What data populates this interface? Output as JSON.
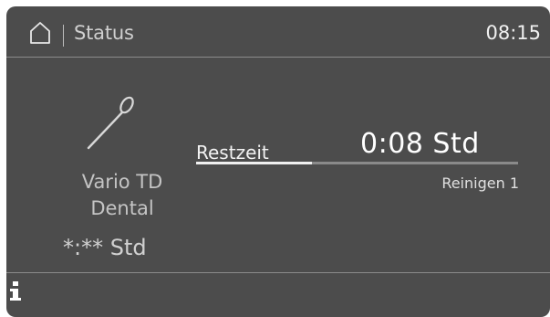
{
  "header": {
    "home_icon": "home-icon",
    "title": "Status",
    "clock": "08:15"
  },
  "program": {
    "icon": "dental-mirror-icon",
    "name_line1": "Vario TD",
    "name_line2": "Dental",
    "total_time": "*:** Std"
  },
  "remaining": {
    "label": "Restzeit",
    "value": "0:08 Std",
    "progress_fraction": 0.36,
    "step": "Reinigen 1"
  },
  "footer": {
    "info_icon": "info-icon"
  },
  "colors": {
    "display_background": "#4c4c4c",
    "text_primary": "#f0f0f0",
    "progress_fill": "#f0f0f0",
    "progress_track": "#8a8a8a"
  }
}
